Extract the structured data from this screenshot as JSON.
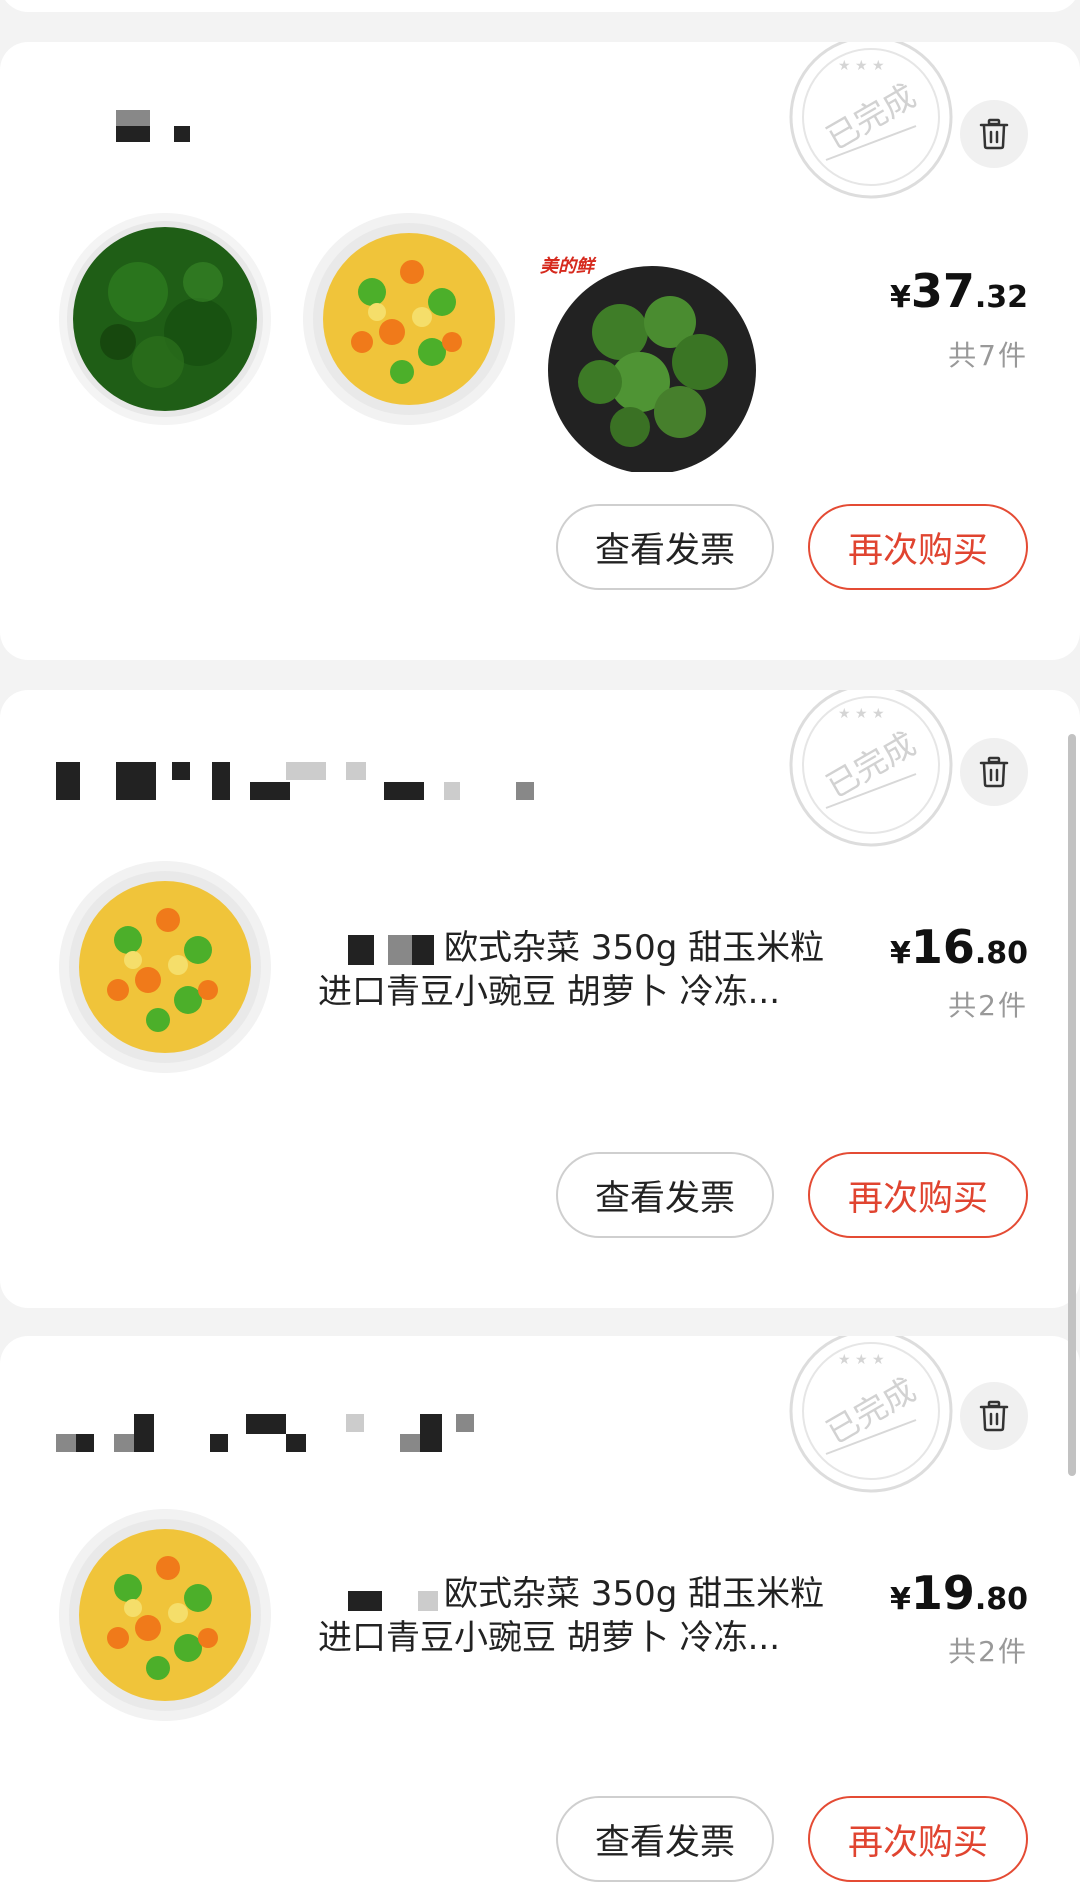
{
  "orders": [
    {
      "status_stamp": "已完成",
      "price": {
        "currency": "¥",
        "integer": "37",
        "decimal": ".32"
      },
      "count_text": "共7件",
      "thumbnails": [
        "chopped-greens",
        "mixed-vegetables",
        "broccoli"
      ],
      "broccoli_logo": "美的鲜",
      "buttons": {
        "invoice": "查看发票",
        "rebuy": "再次购买"
      }
    },
    {
      "status_stamp": "已完成",
      "product_line1": "欧式杂菜 350g 甜玉米粒",
      "product_line2": "进口青豆小豌豆 胡萝卜 冷冻...",
      "price": {
        "currency": "¥",
        "integer": "16",
        "decimal": ".80"
      },
      "count_text": "共2件",
      "thumbnails": [
        "mixed-vegetables"
      ],
      "buttons": {
        "invoice": "查看发票",
        "rebuy": "再次购买"
      }
    },
    {
      "status_stamp": "已完成",
      "product_line1": "欧式杂菜 350g 甜玉米粒",
      "product_line2": "进口青豆小豌豆 胡萝卜 冷冻...",
      "price": {
        "currency": "¥",
        "integer": "19",
        "decimal": ".80"
      },
      "count_text": "共2件",
      "thumbnails": [
        "mixed-vegetables"
      ],
      "buttons": {
        "invoice": "查看发票",
        "rebuy": "再次购买"
      }
    }
  ],
  "colors": {
    "accent": "#e04430",
    "muted": "#999999",
    "background": "#f3f3f3"
  }
}
